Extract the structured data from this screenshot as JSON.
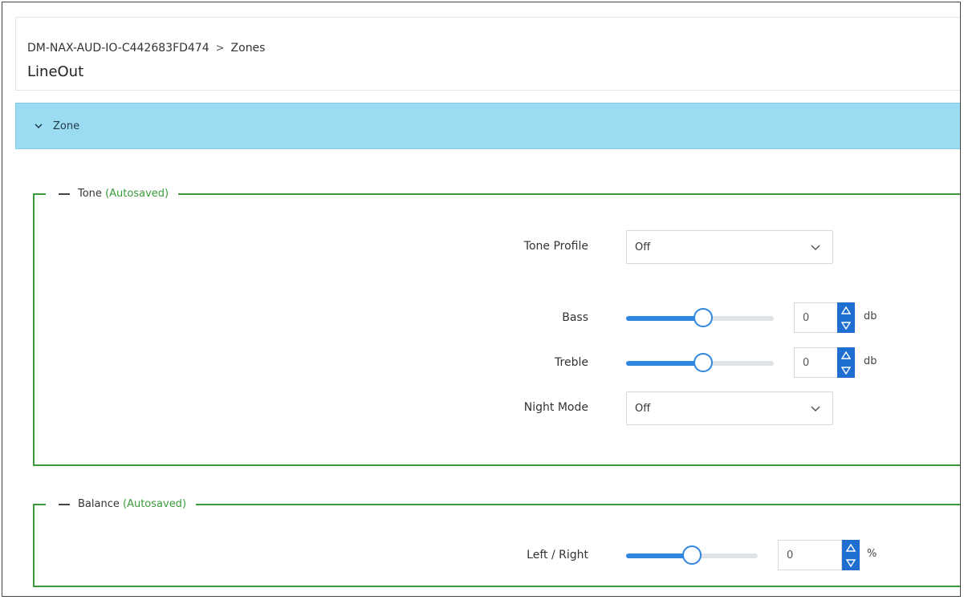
{
  "breadcrumb": {
    "device": "DM-NAX-AUD-IO-C442683FD474",
    "separator": ">",
    "section": "Zones"
  },
  "page_title": "LineOut",
  "zone_header": {
    "label": "Zone"
  },
  "tone": {
    "legend": "Tone",
    "autosaved": "(Autosaved)",
    "tone_profile": {
      "label": "Tone Profile",
      "value": "Off"
    },
    "bass": {
      "label": "Bass",
      "value": "0",
      "unit": "db",
      "slider_fraction": 0.52
    },
    "treble": {
      "label": "Treble",
      "value": "0",
      "unit": "db",
      "slider_fraction": 0.52
    },
    "night_mode": {
      "label": "Night Mode",
      "value": "Off"
    }
  },
  "balance": {
    "legend": "Balance",
    "autosaved": "(Autosaved)",
    "left_right": {
      "label": "Left / Right",
      "value": "0",
      "unit": "%",
      "slider_fraction": 0.5
    }
  },
  "colors": {
    "accent": "#2e86de",
    "group_border": "#3a9b3a",
    "zone_bar": "#9bdcf2"
  }
}
